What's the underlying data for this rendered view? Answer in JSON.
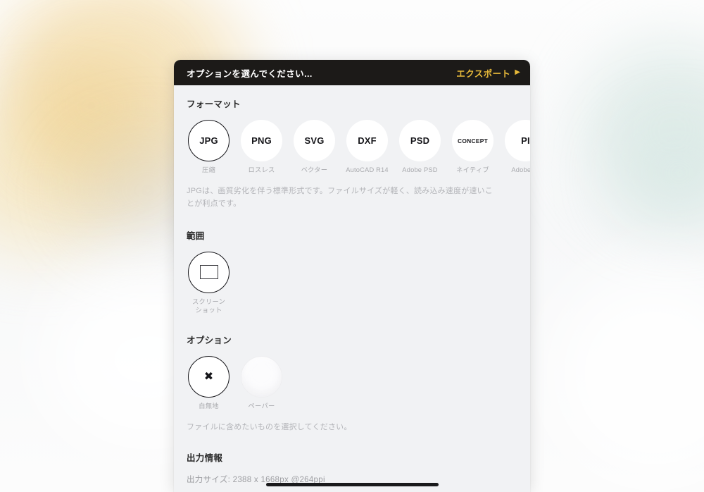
{
  "header": {
    "title": "オプションを選んでください...",
    "export_label": "エクスポート",
    "export_arrow": "▶",
    "bg_color": "#1c1a18",
    "accent_color": "#e7b93a"
  },
  "format_section": {
    "title": "フォーマット",
    "items": [
      {
        "label": "JPG",
        "caption": "圧縮",
        "selected": true
      },
      {
        "label": "PNG",
        "caption": "ロスレス",
        "selected": false
      },
      {
        "label": "SVG",
        "caption": "ベクター",
        "selected": false
      },
      {
        "label": "DXF",
        "caption": "AutoCAD R14",
        "selected": false
      },
      {
        "label": "PSD",
        "caption": "Adobe PSD",
        "selected": false
      },
      {
        "label": "CONCEPT",
        "caption": "ネイティブ",
        "selected": false
      },
      {
        "label": "PI",
        "caption": "Adobe 拡",
        "selected": false
      }
    ],
    "description": "JPGは、画質劣化を伴う標準形式です。ファイルサイズが軽く、読み込み速度が速いことが利点です。"
  },
  "range_section": {
    "title": "範囲",
    "items": [
      {
        "icon": "rectangle-icon",
        "caption": "スクリーン\nショット",
        "selected": true
      }
    ]
  },
  "options_section": {
    "title": "オプション",
    "items": [
      {
        "icon": "x-icon",
        "caption": "白無地",
        "selected": true
      },
      {
        "icon": "paper-texture-icon",
        "caption": "ペーパー",
        "selected": false
      }
    ],
    "hint": "ファイルに含めたいものを選択してください。"
  },
  "output_section": {
    "title": "出力情報",
    "size_text": "出力サイズ: 2388 x 1668px @264ppi"
  },
  "system": {
    "home_indicator": "home-indicator"
  }
}
